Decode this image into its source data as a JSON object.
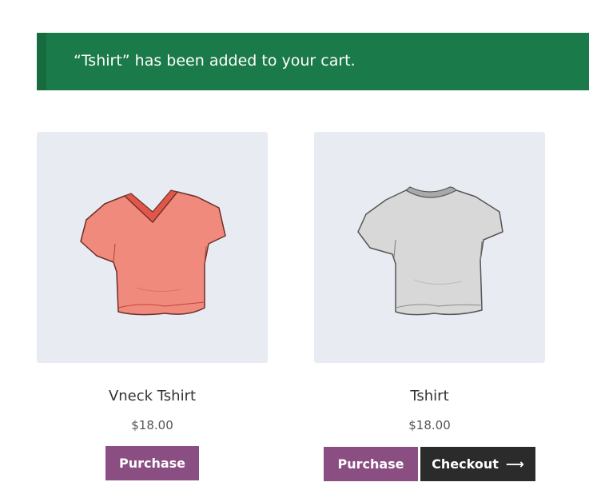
{
  "notice": {
    "message": "“Tshirt” has been added to your cart.",
    "color": "#1b7a49"
  },
  "products": [
    {
      "name": "Vneck Tshirt",
      "price": "$18.00",
      "image_icon": "vneck-tshirt-image",
      "shirt_color": "#f08a7c",
      "buttons": {
        "purchase": "Purchase"
      }
    },
    {
      "name": "Tshirt",
      "price": "$18.00",
      "image_icon": "tshirt-image",
      "shirt_color": "#d8d8d8",
      "buttons": {
        "purchase": "Purchase",
        "checkout": "Checkout",
        "checkout_icon": "arrow-right-icon"
      }
    }
  ],
  "colors": {
    "purchase_button": "#8a4e82",
    "checkout_button": "#2b2b2b",
    "thumbnail_bg": "#e8ecf2"
  }
}
